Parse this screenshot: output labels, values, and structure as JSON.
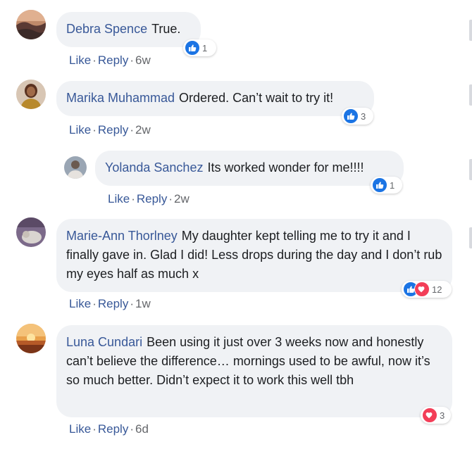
{
  "comments": [
    {
      "author": "Debra Spence",
      "text": "True.",
      "like_label": "Like",
      "reply_label": "Reply",
      "time": "6w",
      "reactions": [
        "like"
      ],
      "reaction_count": "1",
      "avatar": "sunset-hills-avatar"
    },
    {
      "author": "Marika Muhammad",
      "text": "Ordered. Can’t wait to try it!",
      "like_label": "Like",
      "reply_label": "Reply",
      "time": "2w",
      "reactions": [
        "like"
      ],
      "reaction_count": "3",
      "avatar": "portrait-avatar"
    },
    {
      "author": "Yolanda Sanchez",
      "text": "Its worked wonder for me!!!!",
      "like_label": "Like",
      "reply_label": "Reply",
      "time": "2w",
      "reactions": [
        "like"
      ],
      "reaction_count": "1",
      "avatar": "person-avatar"
    },
    {
      "author": "Marie-Ann Thorlney",
      "text": "My daughter kept telling me to try it and I finally gave in. Glad I did! Less drops during the day and I don’t rub my eyes half as much x",
      "like_label": "Like",
      "reply_label": "Reply",
      "time": "1w",
      "reactions": [
        "like",
        "love"
      ],
      "reaction_count": "12",
      "avatar": "cat-avatar"
    },
    {
      "author": "Luna Cundari",
      "text": "Been using it just over 3 weeks now and honestly can’t believe the difference… mornings used to be awful, now it’s so much better. Didn’t expect it to work this well tbh",
      "like_label": "Like",
      "reply_label": "Reply",
      "time": "6d",
      "reactions": [
        "love"
      ],
      "reaction_count": "3",
      "avatar": "sunset-beach-avatar"
    }
  ],
  "colors": {
    "name": "#385898",
    "bubble": "#f0f2f5",
    "like": "#1b74e4",
    "love": "#f33e58",
    "meta": "#65676b"
  }
}
